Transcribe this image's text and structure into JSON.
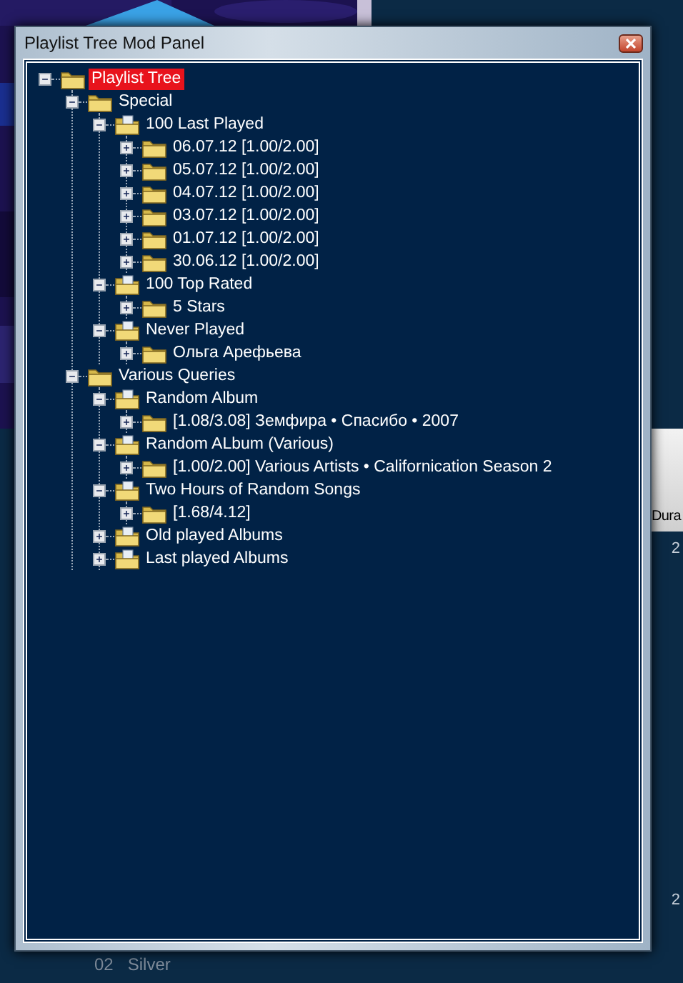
{
  "window": {
    "title": "Playlist Tree Mod Panel"
  },
  "tree": [
    {
      "label": "Playlist Tree",
      "kind": "folder",
      "selected": true,
      "expanded": true,
      "children": [
        {
          "label": "Special",
          "kind": "folder",
          "selected": false,
          "expanded": true,
          "children": [
            {
              "label": "100 Last Played",
              "kind": "query",
              "selected": false,
              "expanded": true,
              "children": [
                {
                  "label": "06.07.12 [1.00/2.00]",
                  "kind": "folder",
                  "selected": false,
                  "expanded": false
                },
                {
                  "label": "05.07.12 [1.00/2.00]",
                  "kind": "folder",
                  "selected": false,
                  "expanded": false
                },
                {
                  "label": "04.07.12 [1.00/2.00]",
                  "kind": "folder",
                  "selected": false,
                  "expanded": false
                },
                {
                  "label": "03.07.12 [1.00/2.00]",
                  "kind": "folder",
                  "selected": false,
                  "expanded": false
                },
                {
                  "label": "01.07.12 [1.00/2.00]",
                  "kind": "folder",
                  "selected": false,
                  "expanded": false
                },
                {
                  "label": "30.06.12 [1.00/2.00]",
                  "kind": "folder",
                  "selected": false,
                  "expanded": false
                }
              ]
            },
            {
              "label": "100 Top Rated",
              "kind": "query",
              "selected": false,
              "expanded": true,
              "children": [
                {
                  "label": "5 Stars",
                  "kind": "folder",
                  "selected": false,
                  "expanded": false
                }
              ]
            },
            {
              "label": "Never Played",
              "kind": "query",
              "selected": false,
              "expanded": true,
              "children": [
                {
                  "label": "Ольга Арефьева",
                  "kind": "folder",
                  "selected": false,
                  "expanded": false
                }
              ]
            }
          ]
        },
        {
          "label": "Various Queries",
          "kind": "folder",
          "selected": false,
          "expanded": true,
          "children": [
            {
              "label": "Random Album",
              "kind": "query",
              "selected": false,
              "expanded": true,
              "children": [
                {
                  "label": "[1.08/3.08] Земфира • Спасибо • 2007",
                  "kind": "folder",
                  "selected": false,
                  "expanded": false
                }
              ]
            },
            {
              "label": "Random ALbum (Various)",
              "kind": "query",
              "selected": false,
              "expanded": true,
              "children": [
                {
                  "label": "[1.00/2.00] Various Artists • Californication Season 2",
                  "kind": "folder",
                  "selected": false,
                  "expanded": false
                }
              ]
            },
            {
              "label": "Two Hours of Random Songs",
              "kind": "query",
              "selected": false,
              "expanded": true,
              "children": [
                {
                  "label": "[1.68/4.12]",
                  "kind": "folder",
                  "selected": false,
                  "expanded": false
                }
              ]
            },
            {
              "label": "Old played Albums",
              "kind": "query",
              "selected": false,
              "expanded": false
            },
            {
              "label": "Last played Albums",
              "kind": "query",
              "selected": false,
              "expanded": false
            }
          ]
        }
      ]
    }
  ],
  "background": {
    "column_header": "Dura",
    "cells": [
      "2",
      "2"
    ],
    "track": {
      "number": "02",
      "title": "Silver"
    }
  }
}
